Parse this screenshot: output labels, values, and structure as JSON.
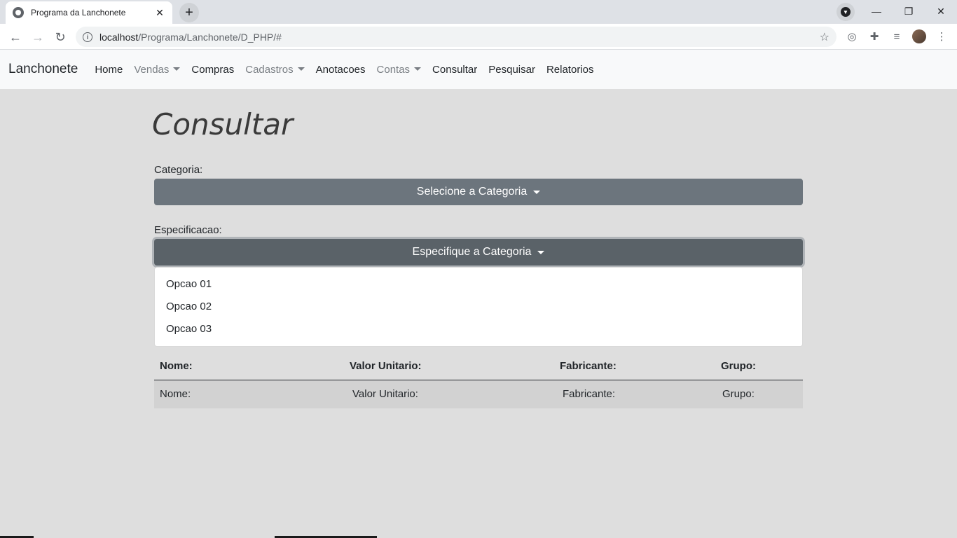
{
  "browser": {
    "tab_title": "Programa da Lanchonete",
    "tab_close": "✕",
    "new_tab": "+",
    "url_host": "localhost",
    "url_path": "/Programa/Lanchonete/D_PHP/#",
    "window_controls": [
      "—",
      "❐",
      "✕"
    ]
  },
  "navbar": {
    "brand": "Lanchonete",
    "items": [
      {
        "label": "Home",
        "dropdown": false,
        "muted": false
      },
      {
        "label": "Vendas",
        "dropdown": true,
        "muted": true
      },
      {
        "label": "Compras",
        "dropdown": false,
        "muted": false
      },
      {
        "label": "Cadastros",
        "dropdown": true,
        "muted": true
      },
      {
        "label": "Anotacoes",
        "dropdown": false,
        "muted": false
      },
      {
        "label": "Contas",
        "dropdown": true,
        "muted": true
      },
      {
        "label": "Consultar",
        "dropdown": false,
        "muted": false
      },
      {
        "label": "Pesquisar",
        "dropdown": false,
        "muted": false
      },
      {
        "label": "Relatorios",
        "dropdown": false,
        "muted": false
      }
    ]
  },
  "page": {
    "title": "Consultar",
    "categoria_label": "Categoria:",
    "categoria_button": "Selecione a Categoria",
    "especificacao_label": "Especificacao:",
    "especificacao_button": "Especifique a Categoria",
    "dropdown_options": [
      "Opcao 01",
      "Opcao 02",
      "Opcao 03"
    ]
  },
  "table": {
    "headers": [
      "Nome:",
      "Valor Unitario:",
      "Fabricante:",
      "Grupo:"
    ],
    "rows": [
      [
        "Nome:",
        "Valor Unitario:",
        "Fabricante:",
        "Grupo:"
      ]
    ]
  },
  "colors": {
    "button_secondary": "#6c757d",
    "button_active": "#5a6268",
    "page_bg": "#dedede",
    "navbar_bg": "#f8f9fa",
    "row_bg": "#d2d2d2"
  }
}
